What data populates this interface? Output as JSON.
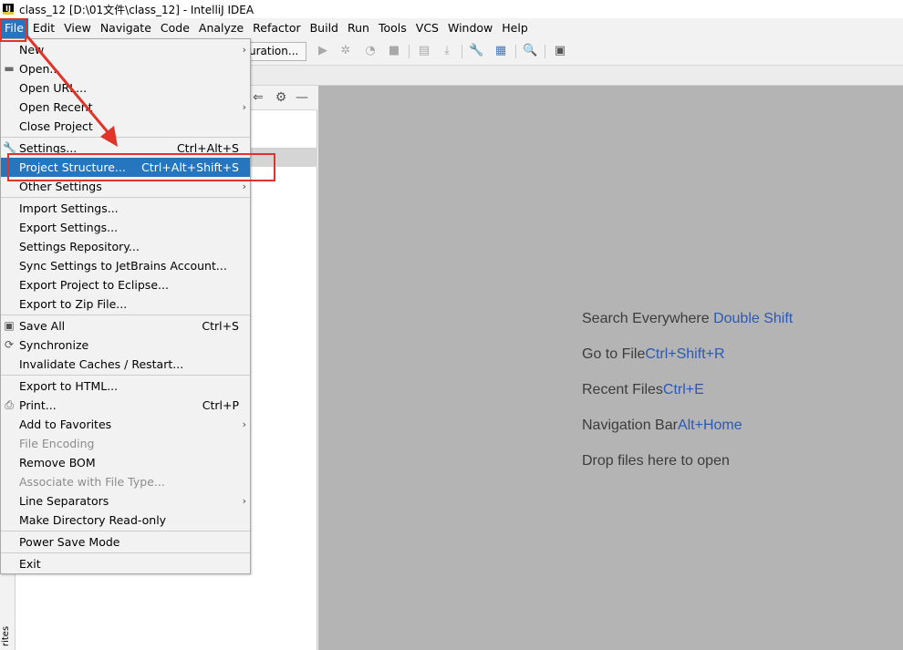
{
  "window": {
    "app_icon_text": "IJ",
    "title": "class_12 [D:\\01文件\\class_12] - IntelliJ IDEA"
  },
  "menubar": {
    "items": [
      {
        "label": "File",
        "active": true
      },
      {
        "label": "Edit"
      },
      {
        "label": "View"
      },
      {
        "label": "Navigate"
      },
      {
        "label": "Code"
      },
      {
        "label": "Analyze"
      },
      {
        "label": "Refactor"
      },
      {
        "label": "Build"
      },
      {
        "label": "Run"
      },
      {
        "label": "Tools"
      },
      {
        "label": "VCS"
      },
      {
        "label": "Window"
      },
      {
        "label": "Help"
      }
    ]
  },
  "toolbar": {
    "run_config_label": "uration..."
  },
  "file_menu": {
    "items": [
      {
        "label": "New",
        "shortcut": "",
        "submenu": true
      },
      {
        "label": "Open...",
        "shortcut": "",
        "icon": "folder-icon"
      },
      {
        "label": "Open URL...",
        "shortcut": ""
      },
      {
        "label": "Open Recent",
        "shortcut": "",
        "submenu": true
      },
      {
        "label": "Close Project",
        "shortcut": ""
      },
      {
        "label": "Settings...",
        "shortcut": "Ctrl+Alt+S",
        "icon": "wrench-icon"
      },
      {
        "label": "Project Structure...",
        "shortcut": "Ctrl+Alt+Shift+S",
        "highlighted": true
      },
      {
        "label": "Other Settings",
        "shortcut": "",
        "submenu": true
      },
      {
        "label": "Import Settings...",
        "shortcut": ""
      },
      {
        "label": "Export Settings...",
        "shortcut": ""
      },
      {
        "label": "Settings Repository...",
        "shortcut": ""
      },
      {
        "label": "Sync Settings to JetBrains Account...",
        "shortcut": ""
      },
      {
        "label": "Export Project to Eclipse...",
        "shortcut": ""
      },
      {
        "label": "Export to Zip File...",
        "shortcut": ""
      },
      {
        "label": "Save All",
        "shortcut": "Ctrl+S",
        "icon": "save-icon"
      },
      {
        "label": "Synchronize",
        "shortcut": "",
        "icon": "sync-icon"
      },
      {
        "label": "Invalidate Caches / Restart...",
        "shortcut": ""
      },
      {
        "label": "Export to HTML...",
        "shortcut": ""
      },
      {
        "label": "Print...",
        "shortcut": "Ctrl+P",
        "icon": "print-icon"
      },
      {
        "label": "Add to Favorites",
        "shortcut": "",
        "submenu": true
      },
      {
        "label": "File Encoding",
        "shortcut": "",
        "disabled": true
      },
      {
        "label": "Remove BOM",
        "shortcut": ""
      },
      {
        "label": "Associate with File Type...",
        "shortcut": "",
        "disabled": true
      },
      {
        "label": "Line Separators",
        "shortcut": "",
        "submenu": true
      },
      {
        "label": "Make Directory Read-only",
        "shortcut": ""
      },
      {
        "label": "Power Save Mode",
        "shortcut": ""
      },
      {
        "label": "Exit",
        "shortcut": ""
      }
    ]
  },
  "editor_hints": [
    {
      "text": "Search Everywhere",
      "shortcut": "Double Shift"
    },
    {
      "text": "Go to File",
      "shortcut": "Ctrl+Shift+R"
    },
    {
      "text": "Recent Files",
      "shortcut": "Ctrl+E"
    },
    {
      "text": "Navigation Bar",
      "shortcut": "Alt+Home"
    },
    {
      "text": "Drop files here to open",
      "shortcut": ""
    }
  ],
  "left_stripe": {
    "favorites_label": "rites"
  },
  "colors": {
    "menu_highlight": "#2675bf",
    "annotation": "#e0342a",
    "shortcut_link": "#2d58b4",
    "editor_background": "#b4b4b4"
  }
}
